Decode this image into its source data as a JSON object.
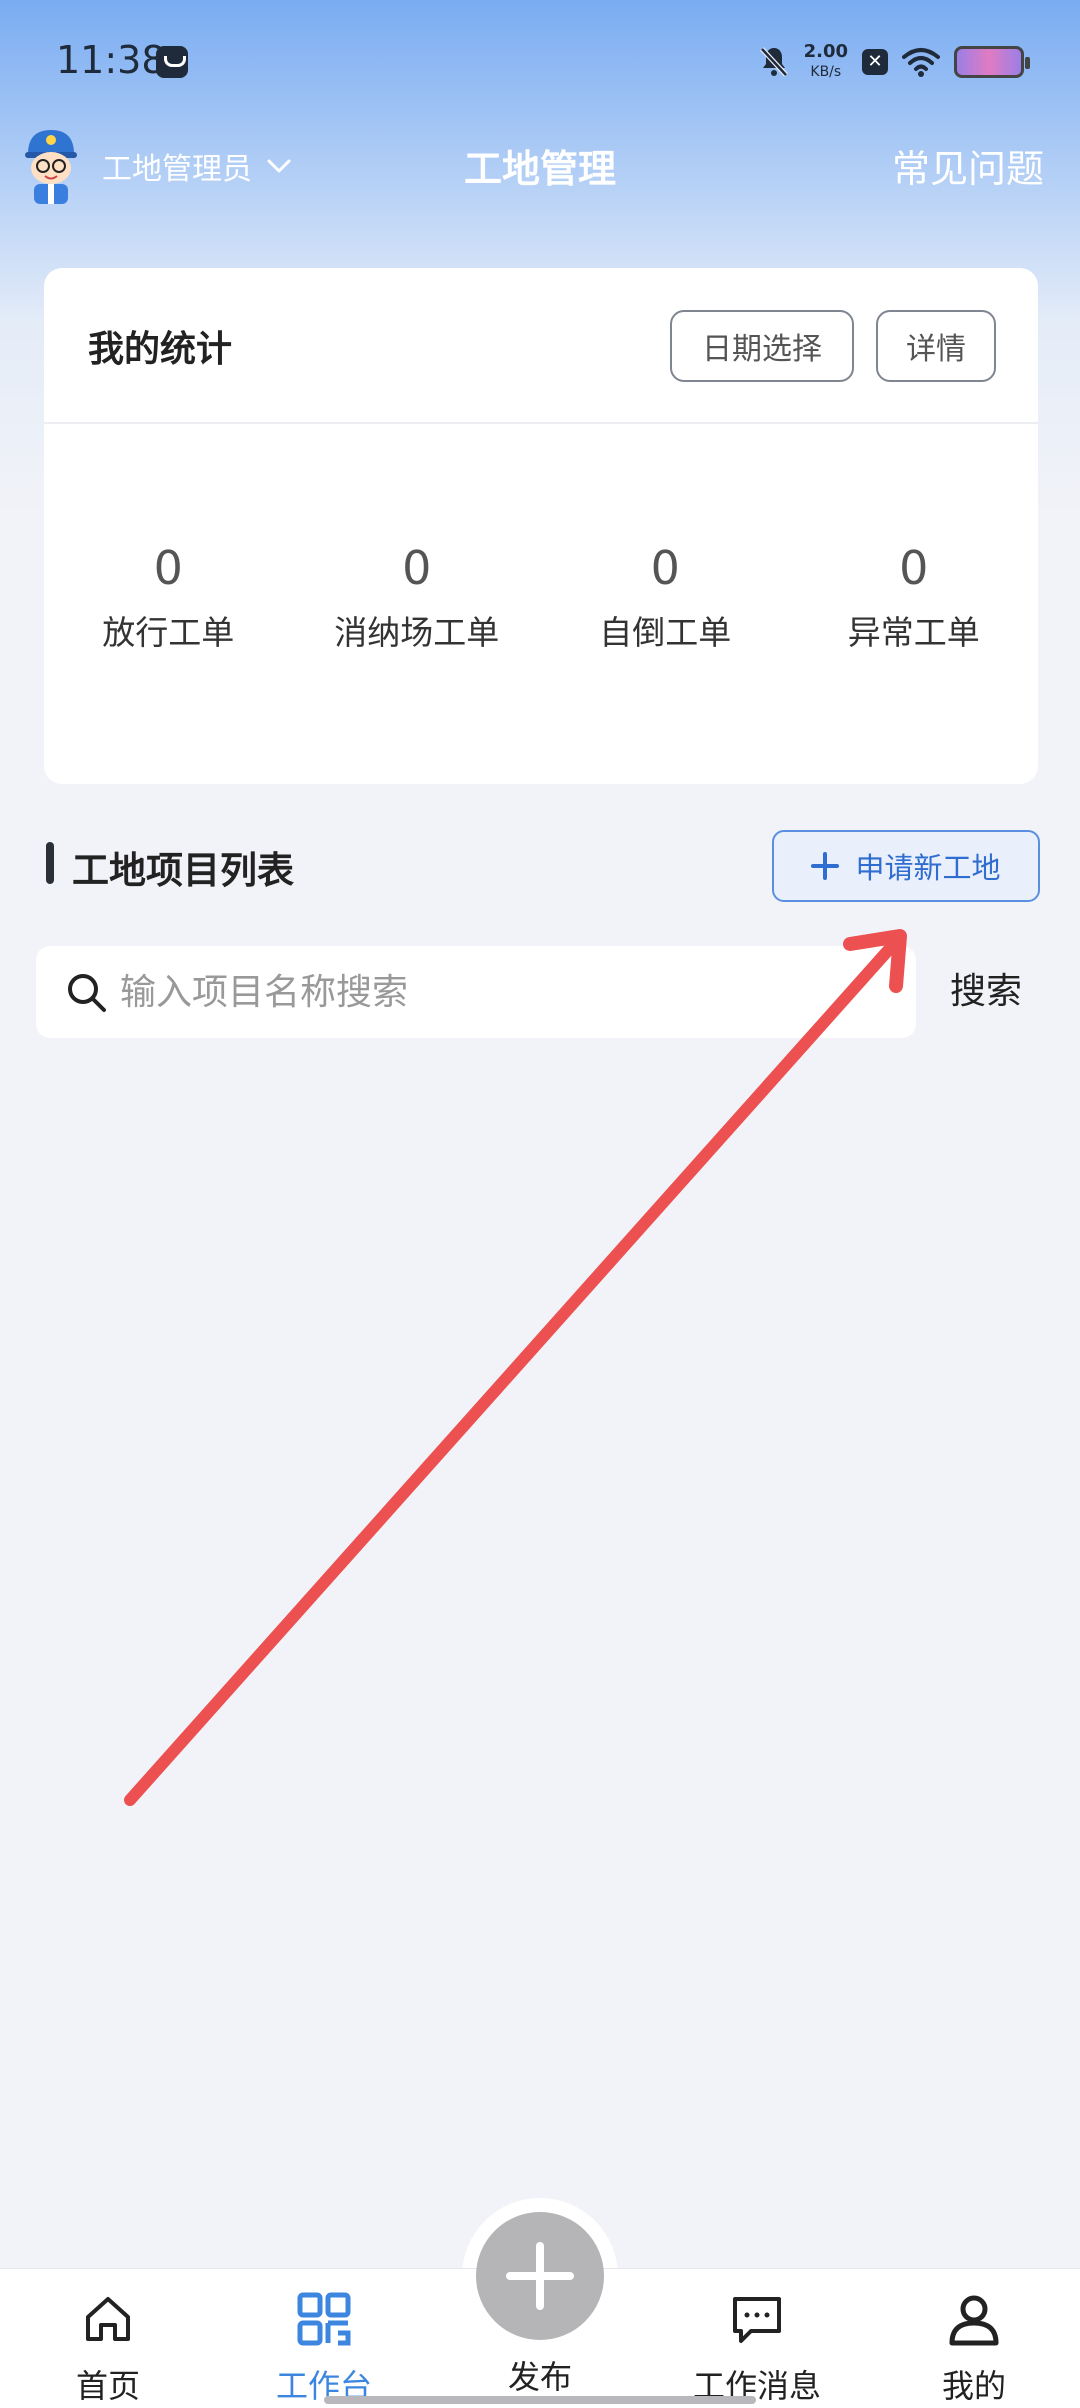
{
  "status_bar": {
    "time": "11:38",
    "speed_value": "2.00",
    "speed_unit": "KB/s",
    "icons": [
      "app-icon",
      "bell-muted-icon",
      "x-box-icon",
      "wifi-icon",
      "battery-icon"
    ]
  },
  "header": {
    "role_label": "工地管理员",
    "title": "工地管理",
    "faq_label": "常见问题"
  },
  "stats": {
    "title": "我的统计",
    "date_button": "日期选择",
    "detail_button": "详情",
    "items": [
      {
        "value": "0",
        "label": "放行工单"
      },
      {
        "value": "0",
        "label": "消纳场工单"
      },
      {
        "value": "0",
        "label": "自倒工单"
      },
      {
        "value": "0",
        "label": "异常工单"
      }
    ]
  },
  "projects": {
    "title": "工地项目列表",
    "apply_button": "申请新工地"
  },
  "search": {
    "placeholder": "输入项目名称搜索",
    "value": "",
    "button": "搜索"
  },
  "nav": {
    "items": [
      {
        "label": "首页",
        "icon": "home-icon",
        "active": false
      },
      {
        "label": "工作台",
        "icon": "qr-grid-icon",
        "active": true
      },
      {
        "label": "发布",
        "icon": "plus-icon",
        "active": false
      },
      {
        "label": "工作消息",
        "icon": "chat-icon",
        "active": false
      },
      {
        "label": "我的",
        "icon": "user-icon",
        "active": false
      }
    ]
  },
  "colors": {
    "accent": "#3d86e0",
    "annotation_arrow": "#ec5050",
    "header_gradient_top": "#7aacf2",
    "background": "#f2f3f8"
  }
}
